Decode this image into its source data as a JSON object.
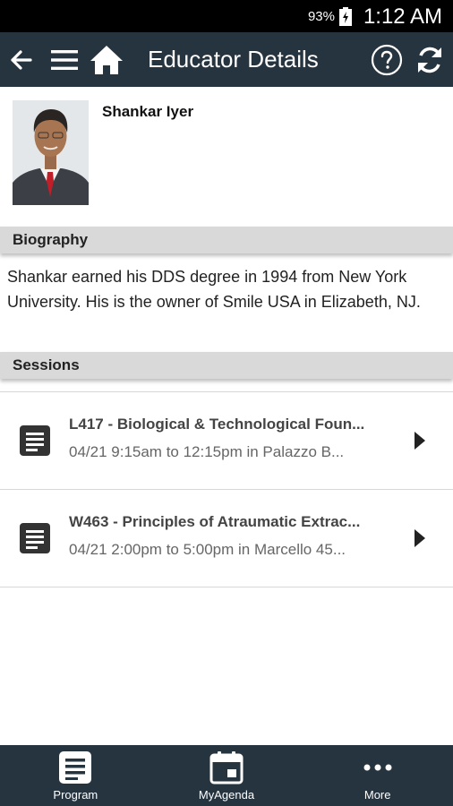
{
  "status_bar": {
    "battery": "93%",
    "time": "1:12 AM"
  },
  "app_bar": {
    "title": "Educator Details"
  },
  "educator": {
    "name": "Shankar Iyer"
  },
  "biography": {
    "header": "Biography",
    "text": "Shankar earned his DDS degree in 1994 from New York University. His is the owner of Smile USA in Elizabeth, NJ."
  },
  "sessions": {
    "header": "Sessions",
    "items": [
      {
        "title": "L417 - Biological & Technological Foun...",
        "subtitle": "04/21 9:15am to 12:15pm in Palazzo B..."
      },
      {
        "title": "W463 - Principles of Atraumatic Extrac...",
        "subtitle": "04/21 2:00pm to 5:00pm in Marcello 45..."
      }
    ]
  },
  "bottom_nav": [
    {
      "label": "Program",
      "icon": "document-icon"
    },
    {
      "label": "MyAgenda",
      "icon": "calendar-icon"
    },
    {
      "label": "More",
      "icon": "more-icon"
    }
  ],
  "colors": {
    "app_bar": "#263440",
    "section_header": "#d9d9d9"
  }
}
